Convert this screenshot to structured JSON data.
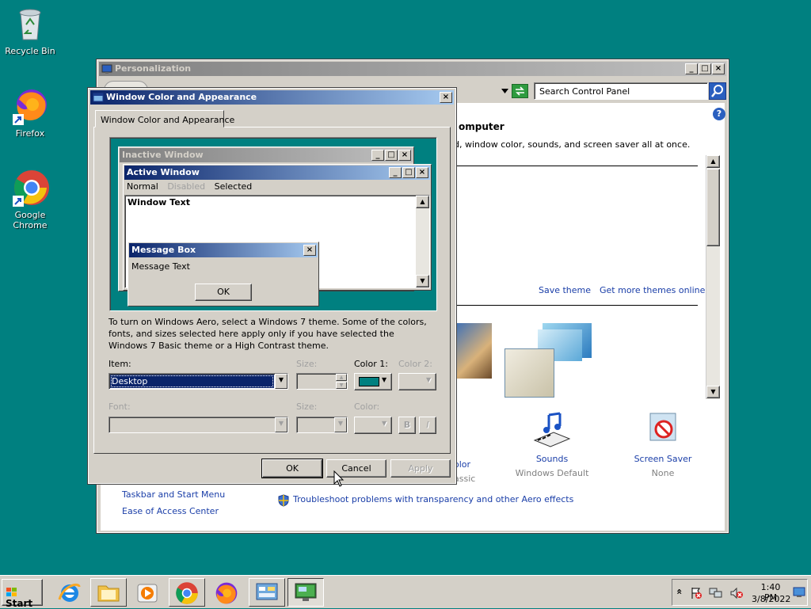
{
  "desktop": {
    "icons": [
      {
        "label": "Recycle Bin"
      },
      {
        "label": "Firefox"
      },
      {
        "label": "Google Chrome"
      }
    ]
  },
  "personalization": {
    "title": "Personalization",
    "search_placeholder": "Search Control Panel",
    "heading_fragment": "omputer",
    "desc_fragment": "d, window color, sounds, and screen saver all at once.",
    "save_theme": "Save theme",
    "more_themes": "Get more themes online",
    "color_fragment": "olor",
    "color_sub_fragment": "assic",
    "sounds_label": "Sounds",
    "sounds_value": "Windows Default",
    "screensaver_label": "Screen Saver",
    "screensaver_value": "None",
    "see_also": [
      "Taskbar and Start Menu",
      "Ease of Access Center"
    ],
    "troubleshoot": "Troubleshoot problems with transparency and other Aero effects"
  },
  "dialog": {
    "title": "Window Color and Appearance",
    "tab": "Window Color and Appearance",
    "preview": {
      "inactive_title": "Inactive Window",
      "active_title": "Active Window",
      "menu": [
        "Normal",
        "Disabled",
        "Selected"
      ],
      "window_text": "Window Text",
      "msgbox_title": "Message Box",
      "msgbox_text": "Message Text",
      "msgbox_ok": "OK"
    },
    "info": "To turn on Windows Aero, select a Windows 7 theme.  Some of the colors, fonts, and sizes selected here apply only if you have selected the Windows 7 Basic theme or a High Contrast theme.",
    "item_label": "Item:",
    "item_value": "Desktop",
    "size_label": "Size:",
    "color1_label": "Color 1:",
    "color2_label": "Color 2:",
    "font_label": "Font:",
    "font_size_label": "Size:",
    "font_color_label": "Color:",
    "bold": "B",
    "italic": "I",
    "color1_value": "#008080",
    "ok": "OK",
    "cancel": "Cancel",
    "apply": "Apply"
  },
  "taskbar": {
    "start": "Start",
    "time": "1:40 PM",
    "date": "3/8/2022",
    "tray_expand": "«"
  },
  "colors": {
    "desktop": "#008080",
    "active_title": "#0a246a",
    "inactive_title": "#808080",
    "link": "#1a3ea8"
  }
}
